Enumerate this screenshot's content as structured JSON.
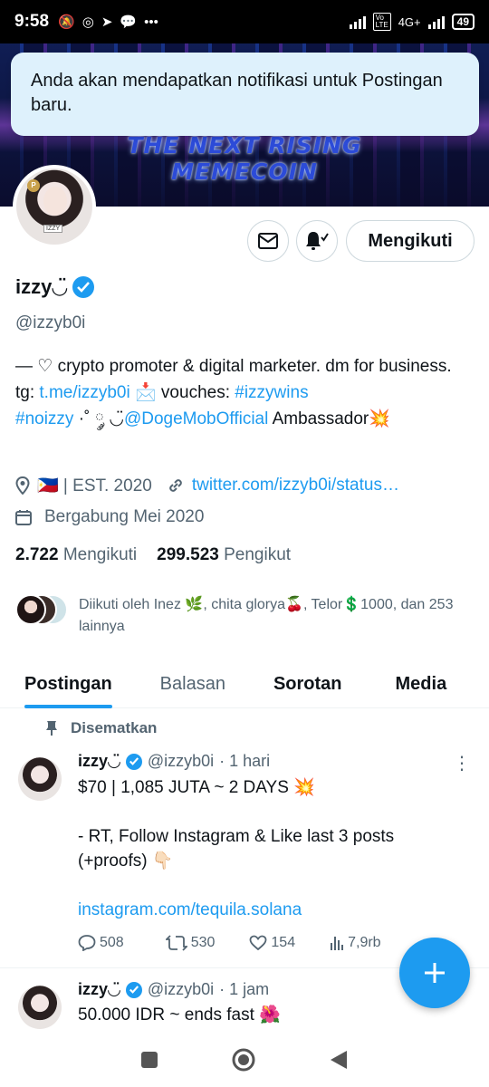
{
  "status_bar": {
    "time": "9:58",
    "network": "4G+",
    "battery": "49",
    "more": "•••"
  },
  "banner": {
    "text": "THE NEXT RISING MEMECOIN"
  },
  "toast": {
    "message": "Anda akan mendapatkan notifikasi untuk Postingan baru."
  },
  "profile": {
    "display_name": "izzy◡̈",
    "handle": "@izzyb0i",
    "follow_button": "Mengikuti",
    "bio": {
      "part1": "— ♡ crypto promoter & digital marketer. dm for business. tg: ",
      "tg_link": "t.me/izzyb0i",
      "part2": " 📩 vouches: ",
      "vouches_link": "#izzywins",
      "hashtag2": "#noizzy",
      "part3": " ·˚ ༘ ◡̈",
      "mention": "@DogeMobOfficial",
      "part4": " Ambassador💥"
    },
    "location": "🇵🇭 | EST. 2020",
    "website": "twitter.com/izzyb0i/status…",
    "joined": "Bergabung Mei 2020",
    "following_count": "2.722",
    "following_label": "Mengikuti",
    "followers_count": "299.523",
    "followers_label": "Pengikut",
    "followed_by": "Diikuti oleh Inez 🌿, chita glorya🍒, Telor💲1000, dan 253 lainnya"
  },
  "tabs": [
    {
      "label": "Postingan",
      "active": true
    },
    {
      "label": "Balasan",
      "active": false
    },
    {
      "label": "Sorotan",
      "active": false
    },
    {
      "label": "Media",
      "active": false
    }
  ],
  "pinned_label": "Disematkan",
  "tweets": [
    {
      "name": "izzy◡̈",
      "handle": "@izzyb0i",
      "time": "· 1 hari",
      "line1": "$70 | 1,085 JUTA ~ 2 DAYS 💥",
      "line2": "- RT, Follow Instagram & Like last 3 posts (+proofs) 👇🏻",
      "link": "instagram.com/tequila.solana",
      "replies": "508",
      "retweets": "530",
      "likes": "154",
      "views": "7,9rb"
    },
    {
      "name": "izzy◡̈",
      "handle": "@izzyb0i",
      "time": "· 1 jam",
      "line1": "50.000 IDR ~ ends fast 🌺"
    }
  ],
  "colors": {
    "accent": "#1d9bf0",
    "toast_bg": "#def1fc",
    "secondary_text": "#536471"
  }
}
